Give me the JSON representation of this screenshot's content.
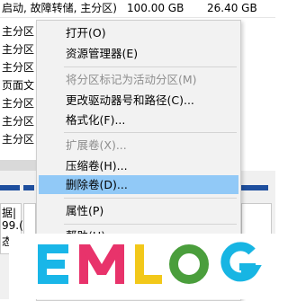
{
  "volumes": {
    "top_row": {
      "status": "启动, 故障转储, 主分区)",
      "capacity": "100.00 GB",
      "free": "26.40 GB"
    },
    "rows": [
      "主分区",
      "主分区",
      "主分区",
      "页面文",
      "主分区",
      "主分区",
      "主分区"
    ],
    "lower_cells": [
      "据|",
      "99.(",
      "态"
    ]
  },
  "context_menu": {
    "items": [
      {
        "label": "打开(O)",
        "enabled": true
      },
      {
        "label": "资源管理器(E)",
        "enabled": true
      },
      {
        "label": "将分区标记为活动分区(M)",
        "enabled": false
      },
      {
        "label": "更改驱动器号和路径(C)...",
        "enabled": true
      },
      {
        "label": "格式化(F)...",
        "enabled": true
      },
      {
        "label": "扩展卷(X)...",
        "enabled": false
      },
      {
        "label": "压缩卷(H)...",
        "enabled": true
      },
      {
        "label": "删除卷(D)...",
        "enabled": true,
        "highlighted": true
      },
      {
        "label": "属性(P)",
        "enabled": true
      },
      {
        "label": "帮助(H)",
        "enabled": true
      }
    ]
  },
  "watermark": {
    "text": "EMLOG",
    "colors": {
      "E": "#19b6e8",
      "M": "#e8336b",
      "L": "#f2c81a",
      "O": "#4a9e3c",
      "G": "#17b5e3"
    }
  }
}
